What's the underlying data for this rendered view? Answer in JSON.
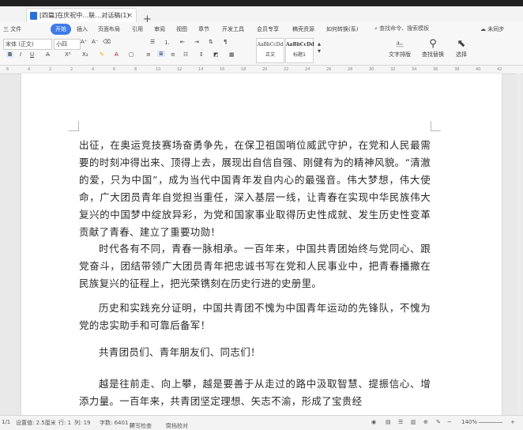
{
  "window": {
    "tab_title": "[四篇]在庆祝中…联…对话稿(1)",
    "tab_close": "×",
    "new_tab": "+"
  },
  "menu": {
    "file": "三 文件",
    "start": "开始",
    "insert": "插入",
    "layout": "页面布局",
    "references": "引用",
    "review": "审阅",
    "view": "视图",
    "chapter": "章节",
    "developer": "开发工具",
    "member": "会员专享",
    "resources": "稿壳资源",
    "convert": "如何转换(系)",
    "search_placeholder": "查找命令、搜索模板",
    "cloud": "未同步"
  },
  "ribbon": {
    "font_name": "宋体 (正文)",
    "font_size": "小四",
    "bold": "B",
    "italic": "I",
    "underline": "U",
    "style_normal_sample": "AaBbCcDd",
    "style_normal": "正文",
    "style_h1_sample": "AaBbCcDd",
    "style_h1": "标题1",
    "text_layout": "文字排版",
    "find_replace": "查找替换",
    "select": "选择"
  },
  "ruler_ticks": [
    "6",
    "4",
    "2",
    "2",
    "4",
    "6",
    "8",
    "10",
    "12",
    "14",
    "16",
    "18",
    "20",
    "22",
    "24",
    "26",
    "28",
    "30",
    "32",
    "34",
    "36",
    "38",
    "40",
    "42"
  ],
  "document": {
    "p1": "出征，在奥运竞技赛场奋勇争先，在保卫祖国哨位威武守护，在党和人民最需要的时刻冲得出来、顶得上去，展现出自信自强、刚健有为的精神风貌。“清澈的爱，只为中国”，成为当代中国青年发自内心的最强音。伟大梦想，伟大使命，广大团员青年自觉担当重任，深入基层一线，让青春在实现中华民族伟大复兴的中国梦中绽放异彩，为党和国家事业取得历史性成就、发生历史性变革贡献了青春、建立了重要功勋！",
    "p2": "时代各有不同，青春一脉相承。一百年来，中国共青团始终与党同心、跟党奋斗，团结带领广大团员青年把忠诚书写在党和人民事业中，把青春播撒在民族复兴的征程上，把光荣镌刻在历史行进的史册里。",
    "p3": "历史和实践充分证明，中国共青团不愧为中国青年运动的先锋队，不愧为党的忠实助手和可靠后备军！",
    "p4": "共青团员们、青年朋友们、同志们！",
    "p5": "越是往前走、向上攀，越是要善于从走过的路中汲取智慧、提振信心、增添力量。一百年来，共青团坚定理想、矢志不渝，形成了宝贵经"
  },
  "status": {
    "page": "1/1",
    "word_count": "设置值: 2.5厘米",
    "line": "行: 1",
    "col": "列: 19",
    "chars": "字数: 6401",
    "spell": "拼写检查",
    "doc_check": "文档校对",
    "zoom": "140%"
  }
}
